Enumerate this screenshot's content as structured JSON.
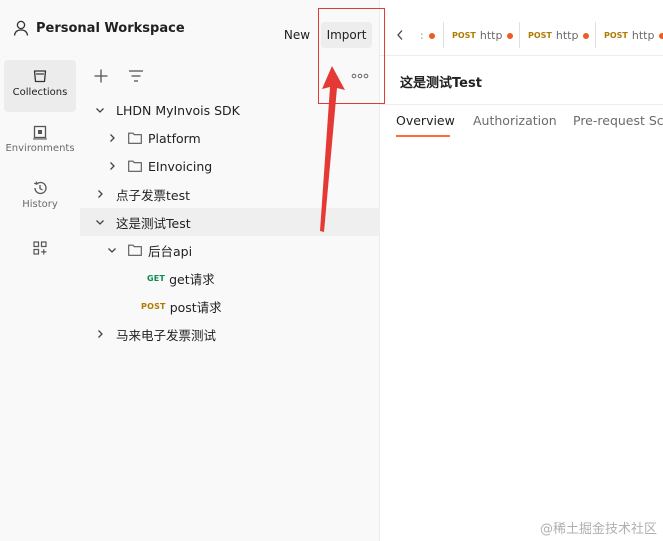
{
  "header": {
    "workspace_title": "Personal Workspace",
    "new_label": "New",
    "import_label": "Import"
  },
  "rail": {
    "items": [
      {
        "label": "Collections",
        "icon": "collections-icon",
        "active": true
      },
      {
        "label": "Environments",
        "icon": "environments-icon",
        "active": false
      },
      {
        "label": "History",
        "icon": "history-icon",
        "active": false
      },
      {
        "label": "",
        "icon": "configure-workbench-icon",
        "active": false
      }
    ]
  },
  "tree": {
    "items": [
      {
        "label": "LHDN MyInvois SDK",
        "kind": "collection",
        "expanded": true
      },
      {
        "label": "Platform",
        "kind": "folder",
        "expanded": false
      },
      {
        "label": "EInvoicing",
        "kind": "folder",
        "expanded": false
      },
      {
        "label": "点子发票test",
        "kind": "collection",
        "expanded": false
      },
      {
        "label": "这是测试Test",
        "kind": "collection",
        "expanded": true,
        "selected": true
      },
      {
        "label": "后台api",
        "kind": "folder",
        "expanded": true
      },
      {
        "label": "get请求",
        "kind": "request",
        "method": "GET"
      },
      {
        "label": "post请求",
        "kind": "request",
        "method": "POST"
      },
      {
        "label": "马来电子发票测试",
        "kind": "collection",
        "expanded": false
      }
    ]
  },
  "tabs": {
    "items": [
      {
        "method": "POST",
        "label": "http"
      },
      {
        "method": "POST",
        "label": "http"
      },
      {
        "method": "POST",
        "label": "http"
      }
    ]
  },
  "request": {
    "title": "这是测试Test",
    "subtabs": [
      "Overview",
      "Authorization",
      "Pre-request Scr"
    ],
    "active_subtab": "Overview"
  },
  "annotation": {
    "color": "#e53935"
  },
  "watermark": "@稀土掘金技术社区",
  "colors": {
    "accent": "#ff6c37",
    "get": "#0c8a4f",
    "post": "#b07a00",
    "unsaved_dot": "#ef5b25"
  }
}
